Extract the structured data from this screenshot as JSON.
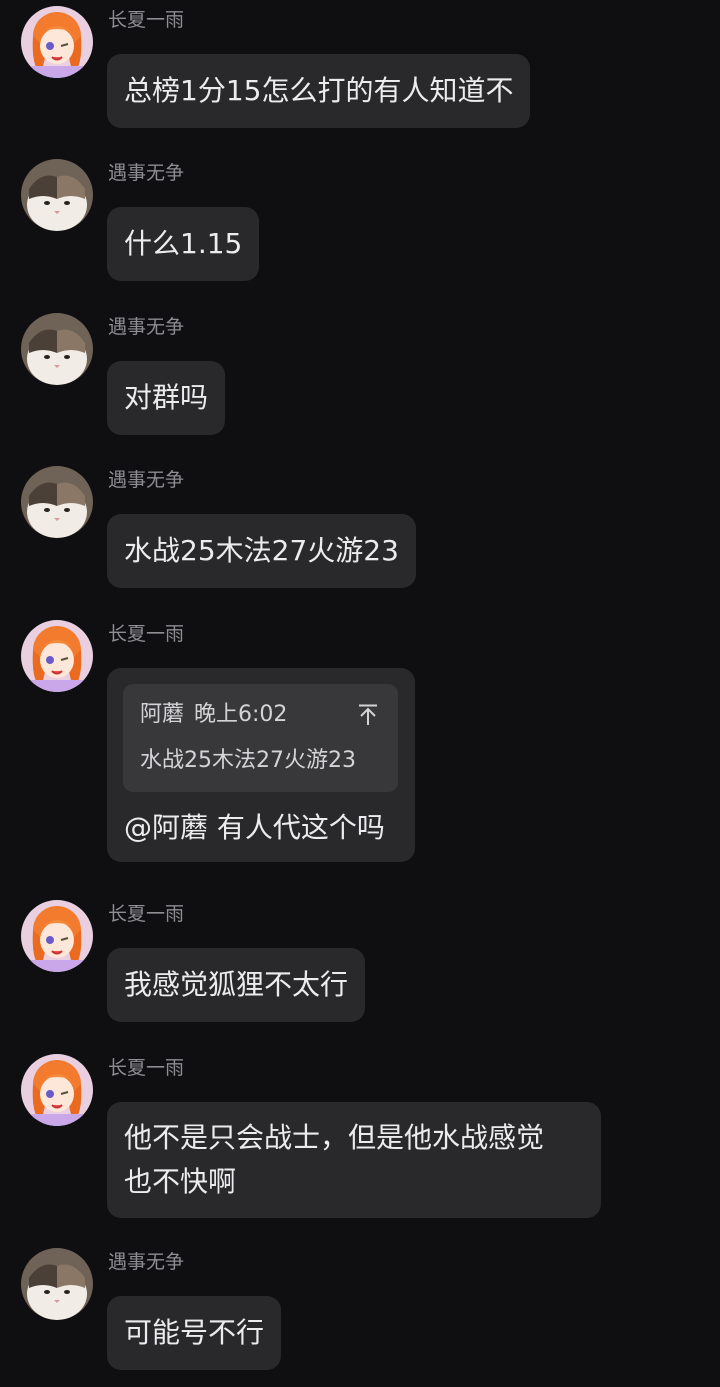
{
  "messages": [
    {
      "sender": "长夏一雨",
      "avatar": "anime-girl-avatar",
      "text": "总榜1分15怎么打的有人知道不"
    },
    {
      "sender": "遇事无争",
      "avatar": "cat-avatar",
      "text": "什么1.15"
    },
    {
      "sender": "遇事无争",
      "avatar": "cat-avatar",
      "text": "对群吗"
    },
    {
      "sender": "遇事无争",
      "avatar": "cat-avatar",
      "text": "水战25木法27火游23"
    },
    {
      "sender": "长夏一雨",
      "avatar": "anime-girl-avatar",
      "quote": {
        "author": "阿蘑",
        "time": "晚上6:02",
        "text": "水战25木法27火游23",
        "icon": "jump-to-message-icon"
      },
      "text": "@阿蘑 有人代这个吗"
    },
    {
      "sender": "长夏一雨",
      "avatar": "anime-girl-avatar",
      "text": "我感觉狐狸不太行"
    },
    {
      "sender": "长夏一雨",
      "avatar": "anime-girl-avatar",
      "lines": [
        "他不是只会战士，但是他水战感觉",
        "也不快啊"
      ]
    },
    {
      "sender": "遇事无争",
      "avatar": "cat-avatar",
      "text": "可能号不行"
    }
  ],
  "colors": {
    "background": "#0f0f11",
    "bubble": "#29292c",
    "quote_block": "#38383b",
    "sender_name": "#8d8d92",
    "message_text": "#ececee"
  }
}
